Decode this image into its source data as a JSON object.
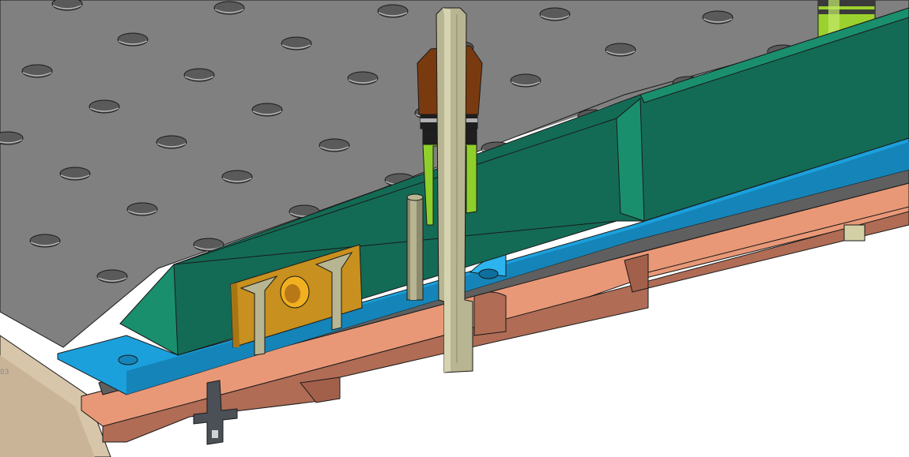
{
  "viewport": {
    "background": "#ffffff"
  },
  "scene": {
    "corner_mark": "03",
    "colors": {
      "plate_top": "#808080",
      "plate_edge": "#6f6f6f",
      "hole_fill": "#5a5a5a",
      "hole_rim": "#b9b9b9",
      "green_front": "#136b55",
      "green_top": "#1a8f6e",
      "blue_strip": "#1ba0dc",
      "blue_strip_dark": "#1584b8",
      "copper_front": "#b06c55",
      "copper_top": "#e99877",
      "gold_bracket": "#c8901e",
      "gold_hole": "#f0b020",
      "pin_body": "#b8b592",
      "pin_shadow": "#8c8a6c",
      "brown_collar": "#7a3a10",
      "lime_sleeve": "#8fcf2a",
      "dark_clip": "#4b5057",
      "beige_base": "#d8c6aa",
      "outline": "#1a1a1a"
    }
  }
}
